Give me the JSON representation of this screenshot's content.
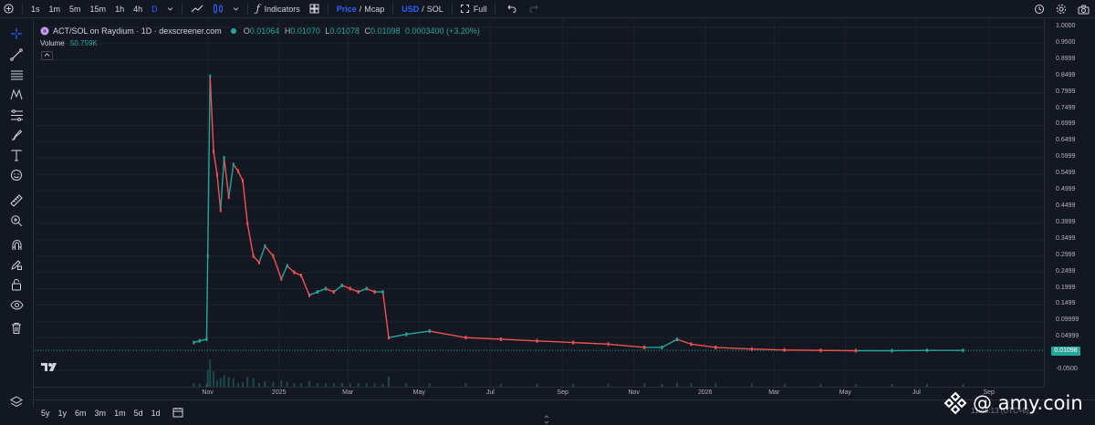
{
  "toolbar": {
    "intervals": [
      "1s",
      "1m",
      "5m",
      "15m",
      "1h",
      "4h",
      "D"
    ],
    "active_interval": "D",
    "indicators_label": "Indicators",
    "price_label": "Price",
    "mcap_label": "Mcap",
    "slash": "/",
    "usd_label": "USD",
    "sol_label": "SOL",
    "full_label": "Full"
  },
  "legend": {
    "title": "ACT/SOL on Raydium · 1D · dexscreener.com",
    "o_key": "O",
    "o": "0.01064",
    "h_key": "H",
    "h": "0.01070",
    "l_key": "L",
    "l": "0.01078",
    "c_key": "C",
    "c": "0.01098",
    "change": "0.0003400 (+3.20%)",
    "volume_label": "Volume",
    "volume_value": "50.759K"
  },
  "price_axis": {
    "ticks": [
      "1.0000",
      "0.9500",
      "0.8999",
      "0.8499",
      "0.7999",
      "0.7499",
      "0.6999",
      "0.6499",
      "0.5999",
      "0.5499",
      "0.4999",
      "0.4499",
      "0.3999",
      "0.3499",
      "0.2999",
      "0.2499",
      "0.1999",
      "0.1499",
      "0.09999",
      "0.04999",
      "-0.0500"
    ],
    "last_price": "0.01098"
  },
  "time_axis": {
    "ticks": [
      "Nov",
      "2025",
      "Mar",
      "May",
      "Jul",
      "Sep",
      "Nov",
      "2026",
      "Mar",
      "May",
      "Jul",
      "Sep"
    ]
  },
  "ranges": [
    "5y",
    "1y",
    "6m",
    "3m",
    "1m",
    "5d",
    "1d"
  ],
  "watermark": "@ amy.coin",
  "clock": "11:49:13 (UTC+8)",
  "colors": {
    "up": "#26a69a",
    "down": "#ef5350",
    "accent": "#2962ff",
    "bg": "#131722"
  },
  "chart_data": {
    "type": "candlestick",
    "pair": "ACT/SOL",
    "interval": "1D",
    "ylim": [
      -0.05,
      1.0
    ],
    "series": [
      {
        "name": "ACT/SOL",
        "x": [
          "2024-10-20",
          "2024-10-25",
          "2024-10-31",
          "2024-11-01",
          "2024-11-03",
          "2024-11-06",
          "2024-11-09",
          "2024-11-12",
          "2024-11-15",
          "2024-11-19",
          "2024-11-23",
          "2024-11-27",
          "2024-12-01",
          "2024-12-05",
          "2024-12-10",
          "2024-12-15",
          "2024-12-20",
          "2024-12-27",
          "2025-01-03",
          "2025-01-08",
          "2025-01-14",
          "2025-01-20",
          "2025-01-27",
          "2025-02-03",
          "2025-02-10",
          "2025-02-17",
          "2025-02-24",
          "2025-03-03",
          "2025-03-10",
          "2025-03-17",
          "2025-03-24",
          "2025-03-31",
          "2025-04-05",
          "2025-04-20",
          "2025-05-10",
          "2025-06-10",
          "2025-07-10",
          "2025-08-10",
          "2025-09-10",
          "2025-10-10",
          "2025-11-10",
          "2025-11-25",
          "2025-12-08",
          "2025-12-20",
          "2026-01-10",
          "2026-02-10",
          "2026-03-10",
          "2026-04-10",
          "2026-05-10",
          "2026-06-10",
          "2026-07-10",
          "2026-08-10"
        ],
        "y": [
          0.035,
          0.04,
          0.045,
          0.3,
          0.85,
          0.62,
          0.55,
          0.44,
          0.6,
          0.48,
          0.58,
          0.56,
          0.53,
          0.4,
          0.3,
          0.28,
          0.33,
          0.3,
          0.23,
          0.27,
          0.25,
          0.24,
          0.18,
          0.19,
          0.2,
          0.19,
          0.21,
          0.2,
          0.19,
          0.2,
          0.19,
          0.19,
          0.05,
          0.06,
          0.07,
          0.05,
          0.045,
          0.04,
          0.035,
          0.03,
          0.02,
          0.02,
          0.045,
          0.03,
          0.02,
          0.015,
          0.012,
          0.011,
          0.01,
          0.01,
          0.011,
          0.011
        ]
      }
    ]
  }
}
